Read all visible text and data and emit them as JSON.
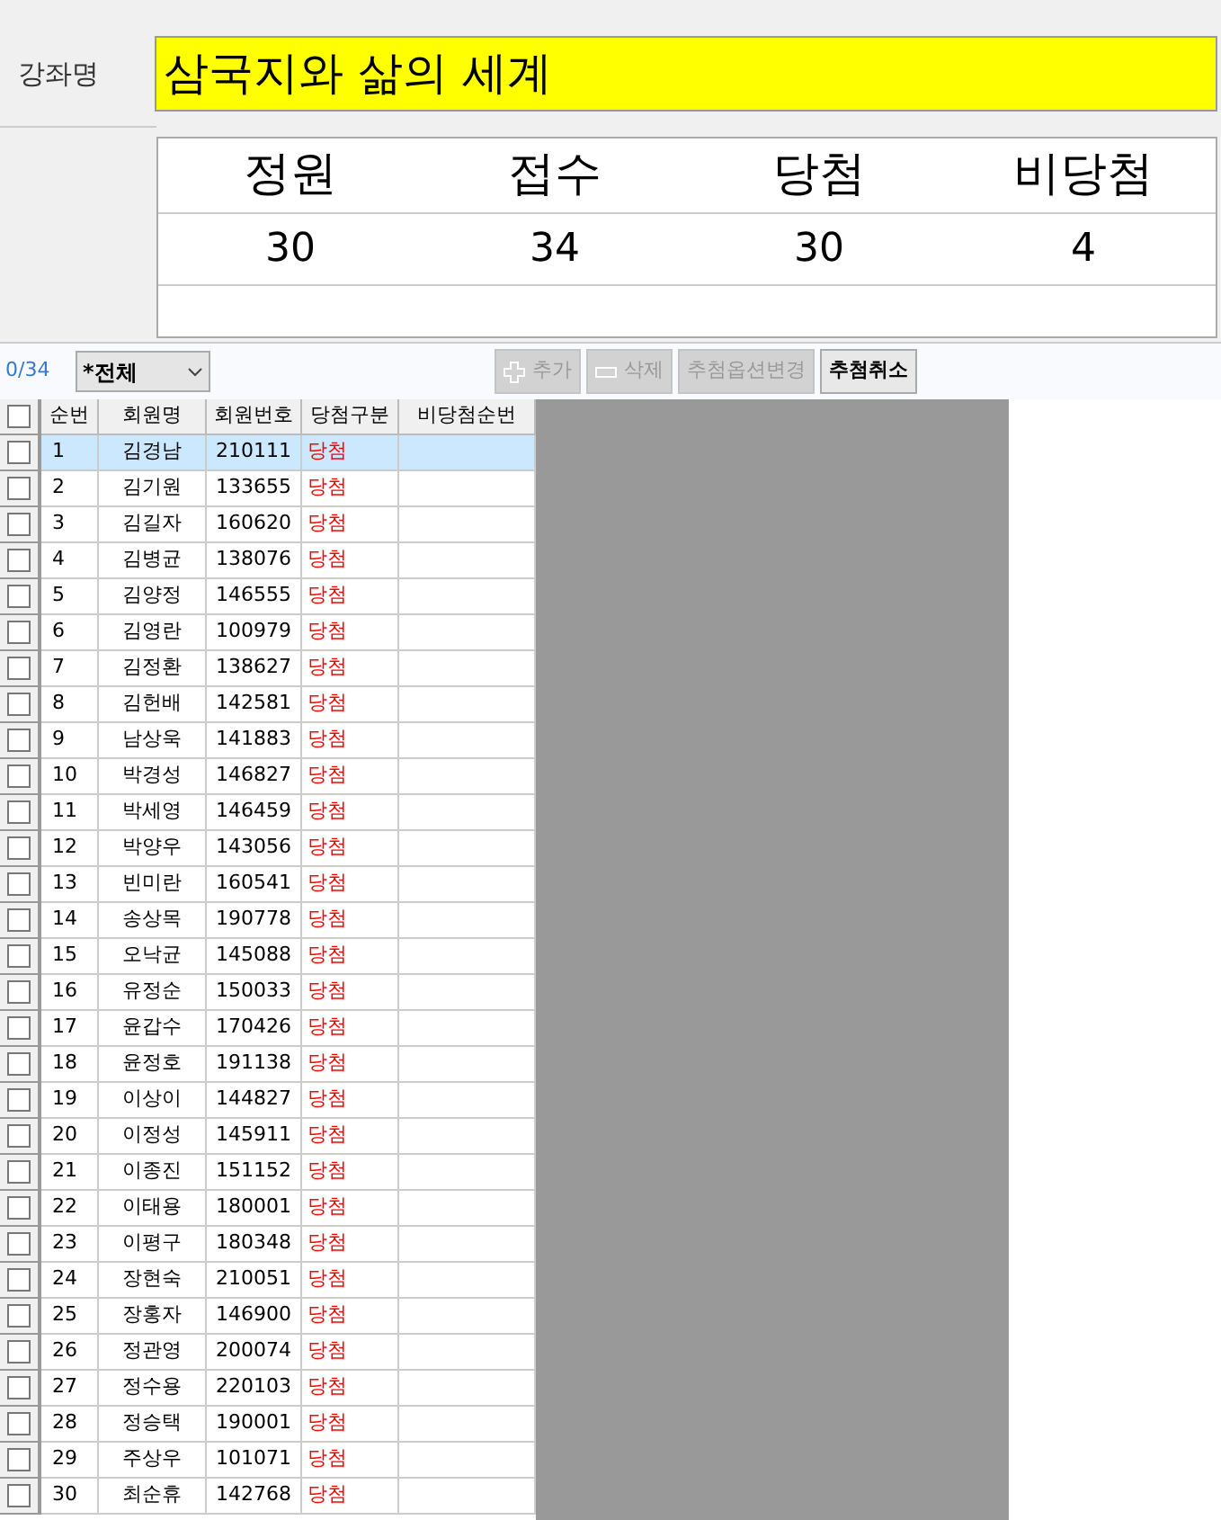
{
  "course": {
    "label": "강좌명",
    "value": "삼국지와 삶의 세계"
  },
  "stats": {
    "columns": [
      "정원",
      "접수",
      "당첨",
      "비당첨"
    ],
    "values": [
      "30",
      "34",
      "30",
      "4"
    ]
  },
  "toolbar": {
    "count": "0/34",
    "filter": "*전체",
    "buttons": [
      {
        "label": "추가",
        "kind": "add",
        "disabled": true
      },
      {
        "label": "삭제",
        "kind": "remove",
        "disabled": true
      },
      {
        "label": "추첨옵션변경",
        "kind": "text",
        "disabled": true
      },
      {
        "label": "추첨취소",
        "kind": "text",
        "disabled": false
      }
    ]
  },
  "table": {
    "header_checked": false,
    "columns": [
      "순번",
      "회원명",
      "회원번호",
      "당첨구분",
      "비당첨순번"
    ],
    "rows": [
      {
        "no": "1",
        "name": "김경남",
        "id": "210111",
        "result": "당첨",
        "checked": false,
        "selected": true
      },
      {
        "no": "2",
        "name": "김기원",
        "id": "133655",
        "result": "당첨",
        "checked": false,
        "selected": false
      },
      {
        "no": "3",
        "name": "김길자",
        "id": "160620",
        "result": "당첨",
        "checked": false,
        "selected": false
      },
      {
        "no": "4",
        "name": "김병균",
        "id": "138076",
        "result": "당첨",
        "checked": false,
        "selected": false
      },
      {
        "no": "5",
        "name": "김양정",
        "id": "146555",
        "result": "당첨",
        "checked": false,
        "selected": false
      },
      {
        "no": "6",
        "name": "김영란",
        "id": "100979",
        "result": "당첨",
        "checked": false,
        "selected": false
      },
      {
        "no": "7",
        "name": "김정환",
        "id": "138627",
        "result": "당첨",
        "checked": false,
        "selected": false
      },
      {
        "no": "8",
        "name": "김헌배",
        "id": "142581",
        "result": "당첨",
        "checked": false,
        "selected": false
      },
      {
        "no": "9",
        "name": "남상욱",
        "id": "141883",
        "result": "당첨",
        "checked": false,
        "selected": false
      },
      {
        "no": "10",
        "name": "박경성",
        "id": "146827",
        "result": "당첨",
        "checked": false,
        "selected": false
      },
      {
        "no": "11",
        "name": "박세영",
        "id": "146459",
        "result": "당첨",
        "checked": false,
        "selected": false
      },
      {
        "no": "12",
        "name": "박양우",
        "id": "143056",
        "result": "당첨",
        "checked": false,
        "selected": false
      },
      {
        "no": "13",
        "name": "빈미란",
        "id": "160541",
        "result": "당첨",
        "checked": false,
        "selected": false
      },
      {
        "no": "14",
        "name": "송상목",
        "id": "190778",
        "result": "당첨",
        "checked": false,
        "selected": false
      },
      {
        "no": "15",
        "name": "오낙균",
        "id": "145088",
        "result": "당첨",
        "checked": false,
        "selected": false
      },
      {
        "no": "16",
        "name": "유정순",
        "id": "150033",
        "result": "당첨",
        "checked": false,
        "selected": false
      },
      {
        "no": "17",
        "name": "윤갑수",
        "id": "170426",
        "result": "당첨",
        "checked": false,
        "selected": false
      },
      {
        "no": "18",
        "name": "윤정호",
        "id": "191138",
        "result": "당첨",
        "checked": false,
        "selected": false
      },
      {
        "no": "19",
        "name": "이상이",
        "id": "144827",
        "result": "당첨",
        "checked": false,
        "selected": false
      },
      {
        "no": "20",
        "name": "이정성",
        "id": "145911",
        "result": "당첨",
        "checked": false,
        "selected": false
      },
      {
        "no": "21",
        "name": "이종진",
        "id": "151152",
        "result": "당첨",
        "checked": false,
        "selected": false
      },
      {
        "no": "22",
        "name": "이태용",
        "id": "180001",
        "result": "당첨",
        "checked": false,
        "selected": false
      },
      {
        "no": "23",
        "name": "이평구",
        "id": "180348",
        "result": "당첨",
        "checked": false,
        "selected": false
      },
      {
        "no": "24",
        "name": "장현숙",
        "id": "210051",
        "result": "당첨",
        "checked": false,
        "selected": false
      },
      {
        "no": "25",
        "name": "장홍자",
        "id": "146900",
        "result": "당첨",
        "checked": false,
        "selected": false
      },
      {
        "no": "26",
        "name": "정관영",
        "id": "200074",
        "result": "당첨",
        "checked": false,
        "selected": false
      },
      {
        "no": "27",
        "name": "정수용",
        "id": "220103",
        "result": "당첨",
        "checked": false,
        "selected": false
      },
      {
        "no": "28",
        "name": "정승택",
        "id": "190001",
        "result": "당첨",
        "checked": false,
        "selected": false
      },
      {
        "no": "29",
        "name": "주상우",
        "id": "101071",
        "result": "당첨",
        "checked": false,
        "selected": false
      },
      {
        "no": "30",
        "name": "최순휴",
        "id": "142768",
        "result": "당첨",
        "checked": false,
        "selected": false
      }
    ]
  }
}
